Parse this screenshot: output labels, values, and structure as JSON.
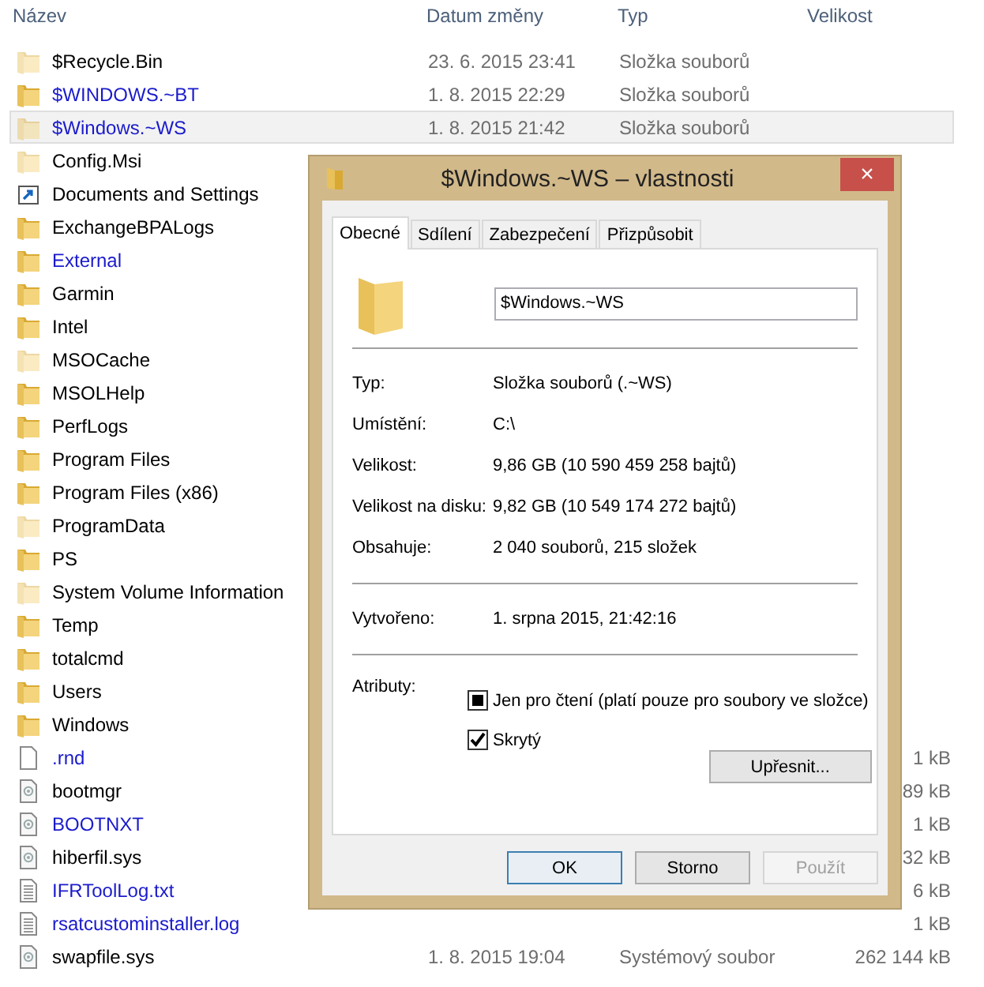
{
  "columns": [
    {
      "label": "Název"
    },
    {
      "label": "Datum změny"
    },
    {
      "label": "Typ"
    },
    {
      "label": "Velikost"
    }
  ],
  "files": [
    {
      "name": "$Recycle.Bin",
      "kind": "folder",
      "hidden": true,
      "color": "#000000",
      "selected": false,
      "date": "23. 6. 2015 23:41",
      "type": "Složka souborů"
    },
    {
      "name": "$WINDOWS.~BT",
      "kind": "folder",
      "hidden": false,
      "color": "#1a1acc",
      "selected": false,
      "date": "1. 8. 2015 22:29",
      "type": "Složka souborů"
    },
    {
      "name": "$Windows.~WS",
      "kind": "folder",
      "hidden": true,
      "color": "#1a1acc",
      "selected": true,
      "date": "1. 8. 2015 21:42",
      "type": "Složka souborů"
    },
    {
      "name": "Config.Msi",
      "kind": "folder",
      "hidden": true,
      "color": "#000000",
      "selected": false
    },
    {
      "name": "Documents and Settings",
      "kind": "shortcut",
      "hidden": false,
      "color": "#000000",
      "selected": false
    },
    {
      "name": "ExchangeBPALogs",
      "kind": "folder",
      "hidden": false,
      "color": "#000000",
      "selected": false
    },
    {
      "name": "External",
      "kind": "folder",
      "hidden": false,
      "color": "#1a1acc",
      "selected": false
    },
    {
      "name": "Garmin",
      "kind": "folder",
      "hidden": false,
      "color": "#000000",
      "selected": false
    },
    {
      "name": "Intel",
      "kind": "folder",
      "hidden": false,
      "color": "#000000",
      "selected": false
    },
    {
      "name": "MSOCache",
      "kind": "folder",
      "hidden": true,
      "color": "#000000",
      "selected": false
    },
    {
      "name": "MSOLHelp",
      "kind": "folder",
      "hidden": false,
      "color": "#000000",
      "selected": false
    },
    {
      "name": "PerfLogs",
      "kind": "folder",
      "hidden": false,
      "color": "#000000",
      "selected": false
    },
    {
      "name": "Program Files",
      "kind": "folder",
      "hidden": false,
      "color": "#000000",
      "selected": false
    },
    {
      "name": "Program Files (x86)",
      "kind": "folder",
      "hidden": false,
      "color": "#000000",
      "selected": false
    },
    {
      "name": "ProgramData",
      "kind": "folder",
      "hidden": true,
      "color": "#000000",
      "selected": false
    },
    {
      "name": "PS",
      "kind": "folder",
      "hidden": false,
      "color": "#000000",
      "selected": false
    },
    {
      "name": "System Volume Information",
      "kind": "folder",
      "hidden": true,
      "color": "#000000",
      "selected": false
    },
    {
      "name": "Temp",
      "kind": "folder",
      "hidden": false,
      "color": "#000000",
      "selected": false
    },
    {
      "name": "totalcmd",
      "kind": "folder",
      "hidden": false,
      "color": "#000000",
      "selected": false
    },
    {
      "name": "Users",
      "kind": "folder",
      "hidden": false,
      "color": "#000000",
      "selected": false
    },
    {
      "name": "Windows",
      "kind": "folder",
      "hidden": false,
      "color": "#000000",
      "selected": false
    },
    {
      "name": ".rnd",
      "kind": "file",
      "hidden": false,
      "color": "#1a1acc",
      "selected": false,
      "size": "1 kB"
    },
    {
      "name": "bootmgr",
      "kind": "system",
      "hidden": false,
      "color": "#000000",
      "selected": false,
      "size": "89 kB"
    },
    {
      "name": "BOOTNXT",
      "kind": "system",
      "hidden": false,
      "color": "#1a1acc",
      "selected": false,
      "size": "1 kB"
    },
    {
      "name": "hiberfil.sys",
      "kind": "system",
      "hidden": false,
      "color": "#000000",
      "selected": false,
      "size": "32 kB"
    },
    {
      "name": "IFRToolLog.txt",
      "kind": "text",
      "hidden": false,
      "color": "#1a1acc",
      "selected": false,
      "size": "6 kB"
    },
    {
      "name": "rsatcustominstaller.log",
      "kind": "text",
      "hidden": false,
      "color": "#1a1acc",
      "selected": false,
      "size": "1 kB"
    },
    {
      "name": "swapfile.sys",
      "kind": "system",
      "hidden": false,
      "color": "#000000",
      "selected": false,
      "date": "1. 8. 2015 19:04",
      "type": "Systémový soubor",
      "size": "262 144 kB"
    }
  ],
  "dialog": {
    "title": "$Windows.~WS – vlastnosti",
    "close": "×",
    "tabs": [
      {
        "label": "Obecné",
        "selected": true
      },
      {
        "label": "Sdílení",
        "selected": false
      },
      {
        "label": "Zabezpečení",
        "selected": false
      },
      {
        "label": "Přizpůsobit",
        "selected": false
      }
    ],
    "name_value": "$Windows.~WS",
    "groups": [
      [
        {
          "label": "Typ:",
          "value": "Složka souborů (.~WS)"
        },
        {
          "label": "Umístění:",
          "value": "C:\\"
        },
        {
          "label": "Velikost:",
          "value": "9,86 GB (10 590 459 258 bajtů)"
        },
        {
          "label": "Velikost na disku:",
          "value": "9,82 GB (10 549 174 272 bajtů)"
        },
        {
          "label": "Obsahuje:",
          "value": "2 040 souborů, 215 složek"
        }
      ],
      [
        {
          "label": "Vytvořeno:",
          "value": "1. srpna 2015, 21:42:16"
        }
      ]
    ],
    "attributes_label": "Atributy:",
    "attributes": [
      {
        "label": "Jen pro čtení (platí pouze pro soubory ve složce)",
        "indeterminate": true
      },
      {
        "label": "Skrytý",
        "checked": true
      }
    ],
    "advanced_button": "Upřesnit...",
    "buttons": [
      {
        "label": "OK",
        "default": true,
        "disabled": false
      },
      {
        "label": "Storno",
        "default": false,
        "disabled": false
      },
      {
        "label": "Použít",
        "default": false,
        "disabled": true
      }
    ]
  }
}
